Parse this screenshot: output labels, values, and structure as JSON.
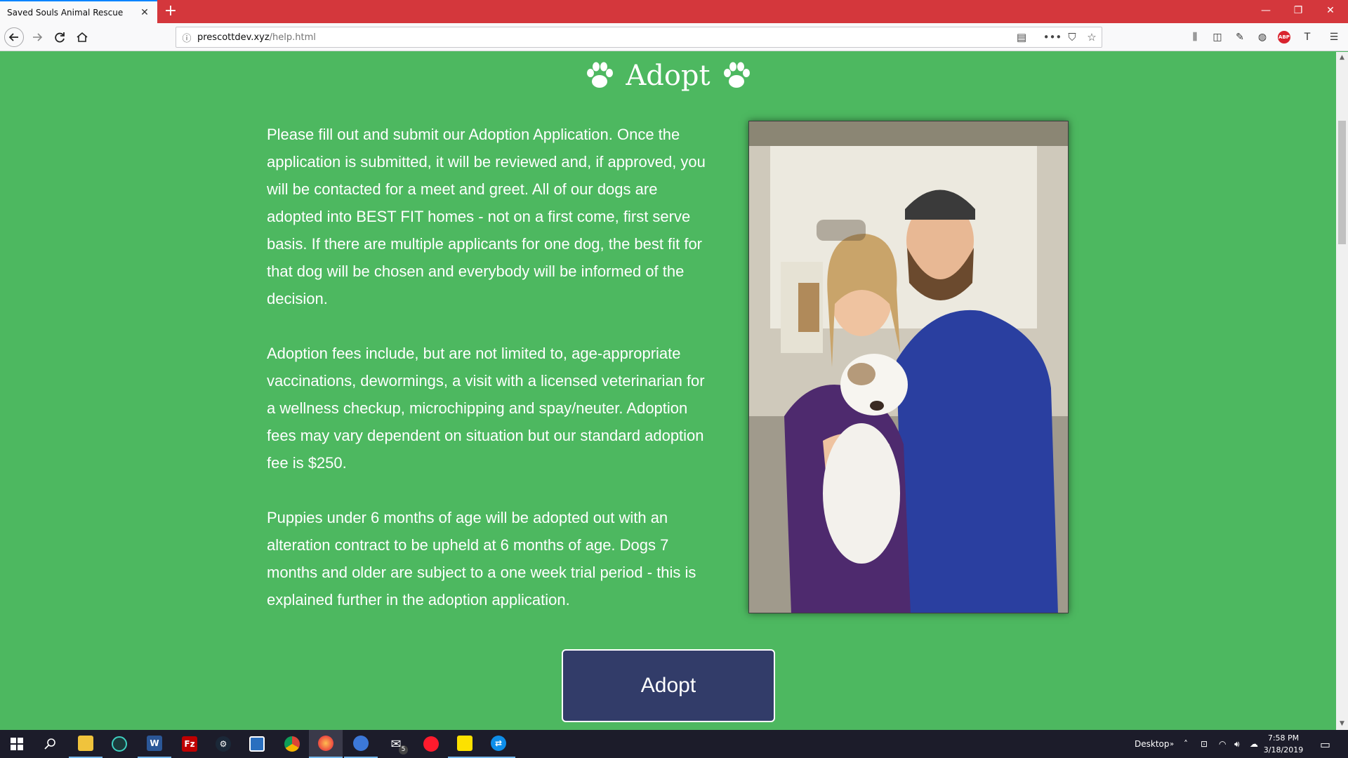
{
  "browser": {
    "tab_title": "Saved Souls Animal Rescue",
    "tab_close": "✕",
    "new_tab": "+",
    "url_domain": "prescottdev.xyz",
    "url_path": "/help.html",
    "window_controls": [
      "—",
      "❐",
      "✕"
    ]
  },
  "page": {
    "heading": "Adopt",
    "paragraphs": [
      "Please fill out and submit our Adoption Application. Once the application is submitted, it will be reviewed and, if approved, you will be contacted for a meet and greet. All of our dogs are adopted into BEST FIT homes - not on a first come, first serve basis. If there are multiple applicants for one dog, the best fit for that dog will be chosen and everybody will be informed of the decision.",
      "Adoption fees include, but are not limited to, age-appropriate vaccinations, dewormings, a visit with a licensed veterinarian for a wellness checkup, microchipping and spay/neuter. Adoption fees may vary dependent on situation but our standard adoption fee is $250.",
      "Puppies under 6 months of age will be adopted out with an alteration contract to be upheld at 6 months of age. Dogs 7 months and older are subject to a one week trial period - this is explained further in the adoption application."
    ],
    "button_label": "Adopt",
    "background_color": "#4db860",
    "button_color": "#323c69"
  },
  "taskbar": {
    "desktop_label": "Desktop",
    "time": "7:58 PM",
    "date": "3/18/2019",
    "mail_badge": "5"
  }
}
